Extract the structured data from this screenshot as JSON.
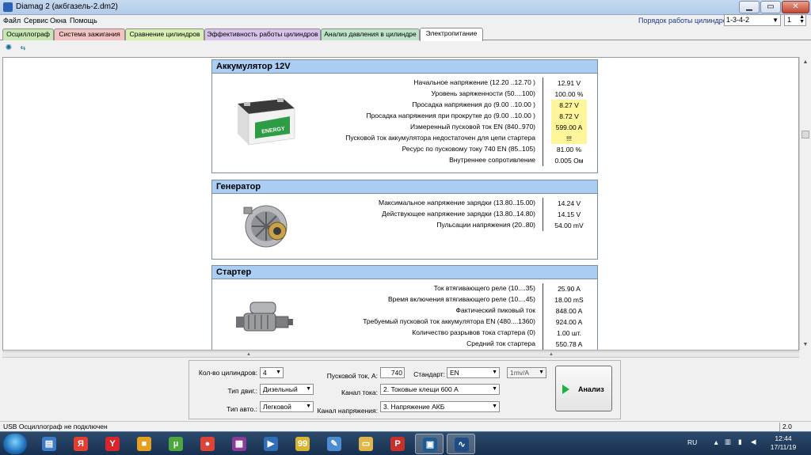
{
  "window": {
    "title": "Diamag 2 (акбгазель-2.dm2)"
  },
  "menu": [
    "Файл",
    "Сервис",
    "Окна",
    "Помощь"
  ],
  "cylinder_order": {
    "label": "Порядок работы цилиндров",
    "value": "1-3-4-2",
    "cylinder": "1"
  },
  "tabs": [
    {
      "label": "Осциллограф",
      "color": "#c6e6b2"
    },
    {
      "label": "Система зажигания",
      "color": "#f3c2c2"
    },
    {
      "label": "Сравнение цилиндров",
      "color": "#d8efb4"
    },
    {
      "label": "Эффективность работы цилиндров",
      "color": "#d7c3ea"
    },
    {
      "label": "Анализ давления в цилиндре",
      "color": "#bfe3c9"
    },
    {
      "label": "Электропитание",
      "color": "#ffffff"
    }
  ],
  "battery": {
    "title": "Аккумулятор 12V",
    "brand": "ENERGY",
    "params": [
      {
        "label": "Начальное напряжение (12.20 ..12.70 )",
        "value": "12.91 V",
        "warn": false
      },
      {
        "label": "Уровень заряженности (50....100)",
        "value": "100.00 %",
        "warn": false
      },
      {
        "label": "Просадка напряжения до (9.00 ..10.00 )",
        "value": "8.27 V",
        "warn": true
      },
      {
        "label": "Просадка напряжения при прокрутке до (9.00 ..10.00 )",
        "value": "8.72 V",
        "warn": true
      },
      {
        "label": "Измеренный пусковой ток  EN (840..970)",
        "value": "599.00 A",
        "warn": true
      },
      {
        "label": "Пусковой ток аккумулятора недостаточен для цепи стартера",
        "value": "!!!",
        "warn": true
      },
      {
        "label": "Ресурс по пусковому току  740 EN (85..105)",
        "value": "81.00 %",
        "warn": false
      },
      {
        "label": "Внутреннее сопротивление",
        "value": "0.005 Ом",
        "warn": false
      }
    ]
  },
  "generator": {
    "title": "Генератор",
    "params": [
      {
        "label": "Максимальное напряжение зарядки  (13.80..15.00)",
        "value": "14.24 V",
        "warn": false
      },
      {
        "label": "Действующее напряжение зарядки (13.80..14.80)",
        "value": "14.15 V",
        "warn": false
      },
      {
        "label": "Пульсации напряжения (20..80)",
        "value": "54.00 mV",
        "warn": false
      }
    ]
  },
  "starter": {
    "title": "Стартер",
    "params": [
      {
        "label": "Ток втягивающего реле (10....35)",
        "value": "25.90 A",
        "warn": false
      },
      {
        "label": "Время включения втягивающего реле (10....45)",
        "value": "18.00 mS",
        "warn": false
      },
      {
        "label": "Фактический пиковый ток",
        "value": "848.00 A",
        "warn": false
      },
      {
        "label": "Требуемый пусковой ток аккумулятора  EN (480....1360)",
        "value": "924.00 A",
        "warn": false
      },
      {
        "label": "Количество разрывов тока стартера (0)",
        "value": "1.00 шт.",
        "warn": false
      },
      {
        "label": "Средний ток стартера",
        "value": "550.78 A",
        "warn": false
      }
    ]
  },
  "controls": {
    "cylinders_label": "Кол-во цилиндров:",
    "cylinders_value": "4",
    "engine_label": "Тип двиг.:",
    "engine_value": "Дизельный",
    "vehicle_label": "Тип авто.:",
    "vehicle_value": "Легковой",
    "start_current_label": "Пусковой ток, А:",
    "start_current_value": "740",
    "standard_label": "Стандарт:",
    "standard_value": "EN",
    "current_channel_label": "Канал тока:",
    "current_channel_value": "2. Токовые клещи 600 А",
    "voltage_channel_label": "Канал напряжения:",
    "voltage_channel_value": "3. Напряжение АКБ",
    "scale_value": "1mv/A",
    "analyze_label": "Анализ"
  },
  "status": {
    "left": "USB Осциллограф не подключен",
    "right": "2.0"
  },
  "taskbar": {
    "lang": "RU",
    "time": "12:44",
    "date": "17/11/19",
    "apps": [
      {
        "icon": "explorer-icon",
        "glyph": "▤",
        "color": "#3b7bc8"
      },
      {
        "icon": "yandex-icon",
        "glyph": "Я",
        "color": "#e53d2f"
      },
      {
        "icon": "yandex-browser-icon",
        "glyph": "Y",
        "color": "#d7262b"
      },
      {
        "icon": "rubik-icon",
        "glyph": "■",
        "color": "#e6a020"
      },
      {
        "icon": "utorrent-icon",
        "glyph": "µ",
        "color": "#4aa83d"
      },
      {
        "icon": "chrome-icon",
        "glyph": "●",
        "color": "#db4437"
      },
      {
        "icon": "winrar-icon",
        "glyph": "▦",
        "color": "#8a3a9a"
      },
      {
        "icon": "media-player-icon",
        "glyph": "▶",
        "color": "#2f6fb6"
      },
      {
        "icon": "total-commander-icon",
        "glyph": "99",
        "color": "#d8b532"
      },
      {
        "icon": "paint-icon",
        "glyph": "✎",
        "color": "#4c8cd0"
      },
      {
        "icon": "folder-icon",
        "glyph": "▭",
        "color": "#e0b54a"
      },
      {
        "icon": "pdf-icon",
        "glyph": "P",
        "color": "#c9302c"
      },
      {
        "icon": "diamag-window-icon",
        "glyph": "▣",
        "color": "#1d5b92"
      },
      {
        "icon": "oscilloscope-icon",
        "glyph": "∿",
        "color": "#1f4c86"
      }
    ]
  }
}
